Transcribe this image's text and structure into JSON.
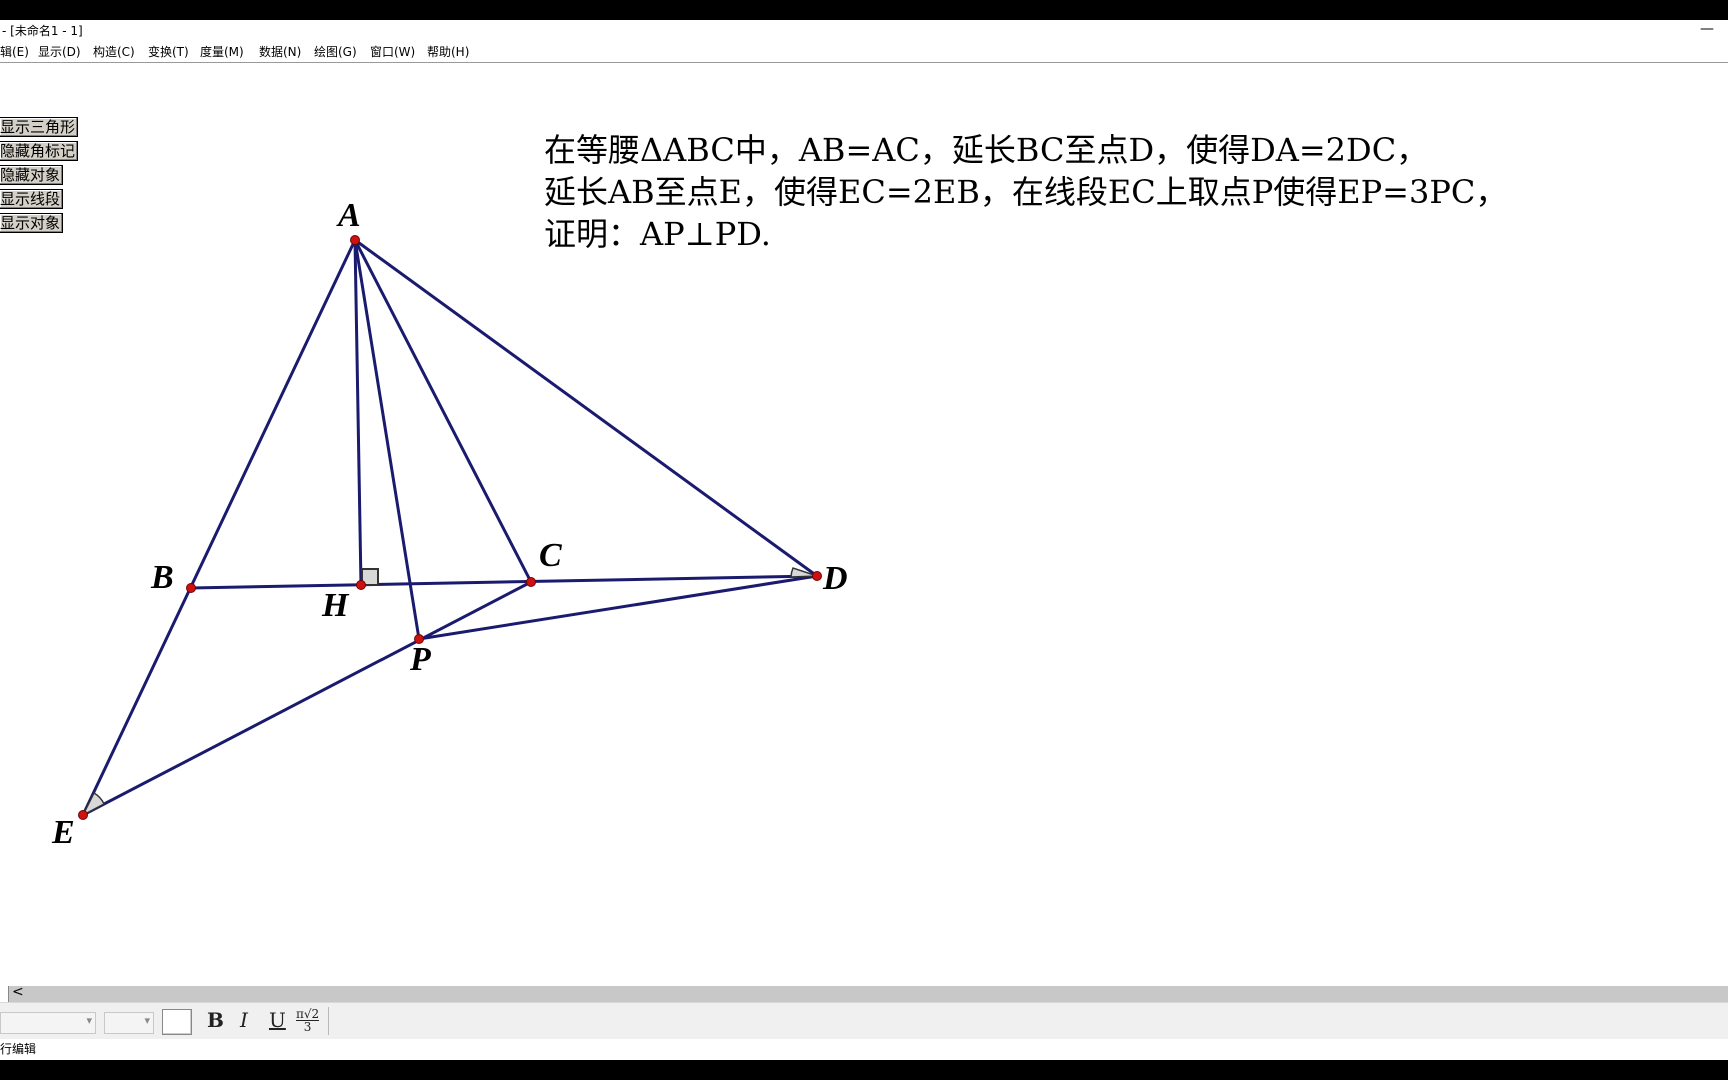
{
  "window": {
    "title": "- [未命名1 - 1]",
    "minimize": "—"
  },
  "menu": [
    "编辑(E)",
    "显示(D)",
    "构造(C)",
    "变换(T)",
    "度量(M)",
    "数据(N)",
    "绘图(G)",
    "窗口(W)",
    "帮助(H)"
  ],
  "buttons": [
    "显示三角形",
    "隐藏角标记",
    "隐藏对象",
    "显示线段",
    "显示对象"
  ],
  "problem": {
    "line1": "在等腰ΔABC中，AB=AC，延长BC至点D，使得DA=2DC，",
    "line2": "延长AB至点E，使得EC=2EB，在线段EC上取点P使得EP=3PC，",
    "line3": "证明：AP⊥PD."
  },
  "points": {
    "A": "A",
    "B": "B",
    "C": "C",
    "D": "D",
    "E": "E",
    "H": "H",
    "P": "P"
  },
  "colors": {
    "segment": "#1a1a6e",
    "point": "#cc1111",
    "menu_border": "#9a9a9a"
  },
  "format": {
    "bold": "B",
    "italic": "I",
    "underline": "U",
    "math_top": "π√2",
    "math_bottom": "3"
  },
  "status": "进行编辑",
  "scroll": {
    "left_arrow": "<"
  }
}
